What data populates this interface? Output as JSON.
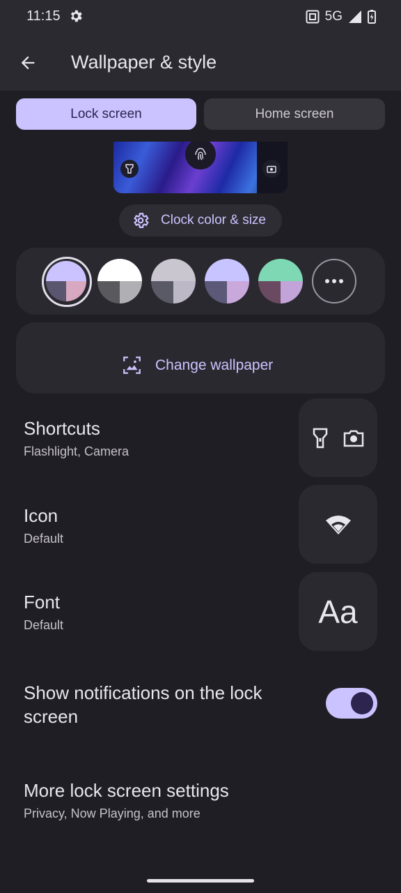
{
  "status_bar": {
    "time": "11:15",
    "network": "5G"
  },
  "app_bar": {
    "title": "Wallpaper & style"
  },
  "tabs": {
    "lock": "Lock screen",
    "home": "Home screen"
  },
  "clock_button": {
    "label": "Clock color & size"
  },
  "color_options": [
    {
      "name": "option-1",
      "selected": true,
      "colors": [
        "#cbc3ff",
        "#cbc3ff",
        "#5a5670",
        "#d8a8c0"
      ]
    },
    {
      "name": "option-2",
      "selected": false,
      "colors": [
        "#ffffff",
        "#ffffff",
        "#5a5a5e",
        "#b0b0b4"
      ]
    },
    {
      "name": "option-3",
      "selected": false,
      "colors": [
        "#c9c6d0",
        "#c9c6d0",
        "#5a5966",
        "#bcb8c6"
      ]
    },
    {
      "name": "option-4",
      "selected": false,
      "colors": [
        "#c8c4ff",
        "#c8c4ff",
        "#5b5878",
        "#c9a8dc"
      ]
    },
    {
      "name": "option-5",
      "selected": false,
      "colors": [
        "#7fd8b4",
        "#7fd8b4",
        "#6a4a60",
        "#c2a4d8"
      ]
    }
  ],
  "wallpaper": {
    "label": "Change wallpaper"
  },
  "settings": {
    "shortcuts": {
      "title": "Shortcuts",
      "subtitle": "Flashlight, Camera"
    },
    "icon": {
      "title": "Icon",
      "subtitle": "Default"
    },
    "font": {
      "title": "Font",
      "subtitle": "Default",
      "sample": "Aa"
    },
    "notifications": {
      "title": "Show notifications on the lock screen",
      "enabled": true
    },
    "more": {
      "title": "More lock screen settings",
      "subtitle": "Privacy, Now Playing, and more"
    }
  },
  "colors": {
    "accent": "#cbc3ff",
    "background": "#1f1e24",
    "surface": "#2a2930"
  }
}
